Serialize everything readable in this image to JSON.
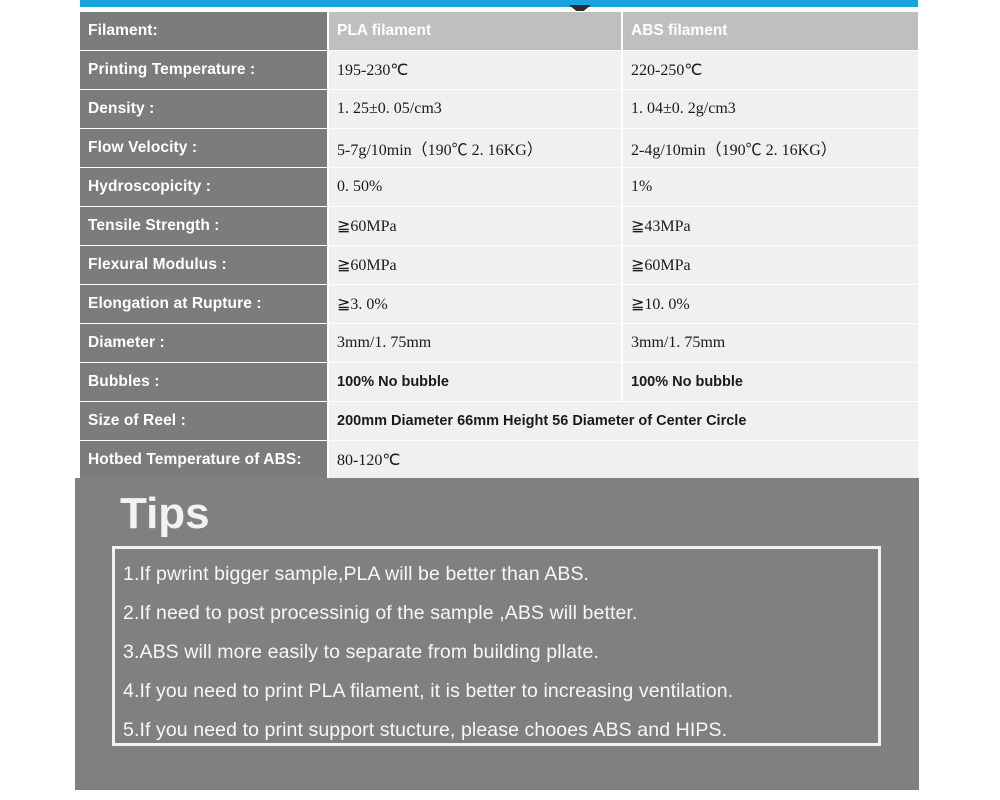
{
  "topbar": {
    "color": "#17a3dc",
    "arrow_icon": "triangle-down-icon",
    "arrow_color": "#2b2b2b"
  },
  "table": {
    "columns": [
      "Filament:",
      "PLA filament",
      "ABS filament"
    ],
    "rows": [
      {
        "label": "Filament:",
        "pla": "PLA filament",
        "abs": "ABS filament",
        "header": true,
        "span": false,
        "sans": false
      },
      {
        "label": "Printing Temperature  :",
        "pla": "195-230℃",
        "abs": "220-250℃",
        "header": false,
        "span": false,
        "sans": false
      },
      {
        "label": "Density  :",
        "pla": "1. 25±0. 05/cm3",
        "abs": "1. 04±0. 2g/cm3",
        "header": false,
        "span": false,
        "sans": false
      },
      {
        "label": "Flow Velocity  :",
        "pla": "5-7g/10min（190℃  2. 16KG）",
        "abs": "2-4g/10min（190℃  2. 16KG）",
        "header": false,
        "span": false,
        "sans": false
      },
      {
        "label": "Hydroscopicity  :",
        "pla": "0. 50%",
        "abs": "1%",
        "header": false,
        "span": false,
        "sans": false
      },
      {
        "label": "Tensile Strength :",
        "pla": "≧60MPa",
        "abs": "≧43MPa",
        "header": false,
        "span": false,
        "sans": false
      },
      {
        "label": "Flexural Modulus :",
        "pla": "≧60MPa",
        "abs": "≧60MPa",
        "header": false,
        "span": false,
        "sans": false
      },
      {
        "label": "Elongation at Rupture :",
        "pla": "≧3. 0%",
        "abs": "≧10. 0%",
        "header": false,
        "span": false,
        "sans": false
      },
      {
        "label": "Diameter  :",
        "pla": "3mm/1. 75mm",
        "abs": "3mm/1. 75mm",
        "header": false,
        "span": false,
        "sans": false
      },
      {
        "label": "Bubbles  :",
        "pla": "100% No bubble",
        "abs": "100% No bubble",
        "header": false,
        "span": false,
        "sans": true
      },
      {
        "label": "Size of Reel  :",
        "pla": "200mm Diameter  66mm Height   56 Diameter of Center Circle",
        "abs": "",
        "header": false,
        "span": true,
        "sans": true
      },
      {
        "label": "Hotbed Temperature of ABS:",
        "pla": "80-120℃",
        "abs": "",
        "header": false,
        "span": true,
        "sans": false
      }
    ]
  },
  "tips": {
    "title": "Tips",
    "lines": [
      "1.If pwrint bigger sample,PLA will be better than ABS.",
      "2.If need to post processinig of the sample ,ABS will better.",
      "3.ABS will more easily to separate from building pllate.",
      "4.If you need to print PLA filament, it is better to increasing ventilation.",
      "5.If you need to print support stucture, please chooes ABS and HIPS."
    ]
  },
  "colors": {
    "accent_blue": "#17a3dc",
    "label_gray": "#7c7c7c",
    "header_value_gray": "#bfbfbf",
    "value_bg": "#f0f0f0",
    "panel_gray": "#808080"
  }
}
